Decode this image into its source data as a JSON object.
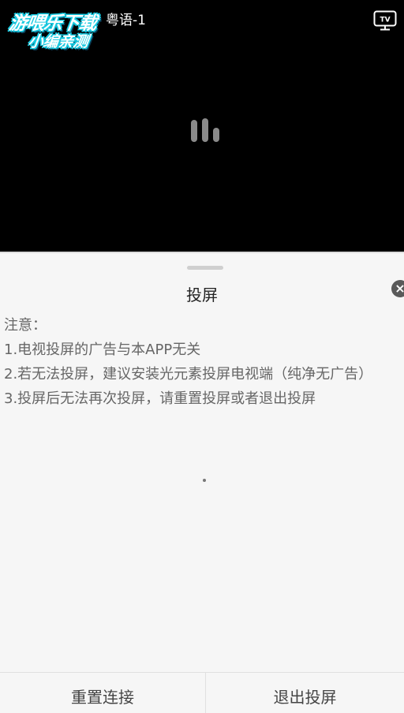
{
  "watermark": {
    "line1": "游喂乐下载",
    "line2": "小编亲测"
  },
  "player": {
    "title": "粤语-1",
    "cast_icon": "tv-icon",
    "loading_icon": "loading-bars-icon"
  },
  "sheet": {
    "title": "投屏",
    "close_icon": "close-icon",
    "close_glyph": "×",
    "notes": [
      "注意：",
      "1.电视投屏的广告与本APP无关",
      "2.若无法投屏，建议安装光元素投屏电视端（纯净无广告）",
      "3.投屏后无法再次投屏，请重置投屏或者退出投屏"
    ],
    "loading_dot_icon": "loading-dot-icon"
  },
  "actions": {
    "reset_label": "重置连接",
    "exit_label": "退出投屏"
  },
  "colors": {
    "player_background": "#000000",
    "sheet_background": "#f6f6f6",
    "note_text": "#666666",
    "watermark_accent": "#16c9e0"
  }
}
